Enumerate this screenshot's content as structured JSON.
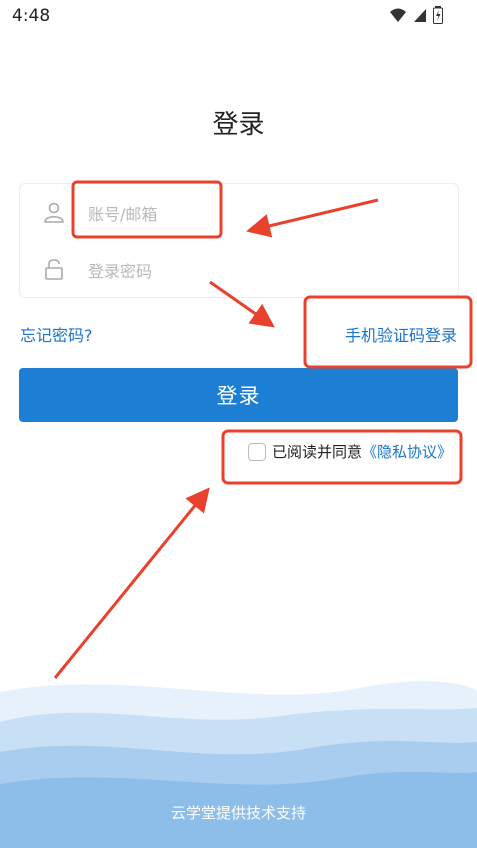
{
  "status_bar": {
    "time": "4:48"
  },
  "page": {
    "title": "登录"
  },
  "form": {
    "username_placeholder": "账号/邮箱",
    "password_placeholder": "登录密码"
  },
  "links": {
    "forgot_password": "忘记密码?",
    "sms_login": "手机验证码登录"
  },
  "login_button": "登录",
  "agreement": {
    "checked": false,
    "text": "已阅读并同意",
    "policy_link": "《隐私协议》"
  },
  "footer": {
    "text": "云学堂提供技术支持"
  },
  "colors": {
    "accent": "#1d7fd3",
    "link": "#1a74c9",
    "annotation": "#e8412c"
  }
}
